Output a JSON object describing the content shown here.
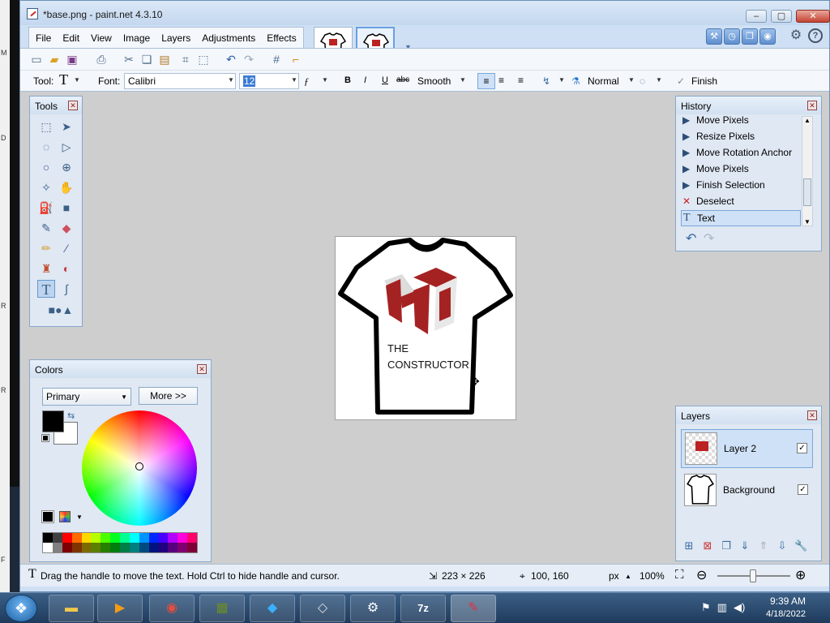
{
  "window": {
    "title": "*base.png - paint.net 4.3.10"
  },
  "menus": [
    "File",
    "Edit",
    "View",
    "Image",
    "Layers",
    "Adjustments",
    "Effects"
  ],
  "toolbar": {
    "tool_label": "Tool:",
    "font_label": "Font:",
    "font_value": "Calibri",
    "size_value": "12",
    "antialias_value": "Smooth",
    "blend_value": "Normal",
    "finish_label": "Finish",
    "bold": "B",
    "italic": "I",
    "underline": "U",
    "strike": "abc"
  },
  "tools_panel": {
    "title": "Tools"
  },
  "colors_panel": {
    "title": "Colors",
    "mode": "Primary",
    "more_label": "More >>",
    "primary_color": "#000000",
    "secondary_color": "#ffffff"
  },
  "history_panel": {
    "title": "History",
    "items": [
      "Move Pixels",
      "Resize Pixels",
      "Move Rotation Anchor",
      "Move Pixels",
      "Finish Selection",
      "Deselect",
      "Text"
    ],
    "selected_index": 6
  },
  "layers_panel": {
    "title": "Layers",
    "layers": [
      {
        "name": "Layer 2",
        "visible": true,
        "selected": true
      },
      {
        "name": "Background",
        "visible": true,
        "selected": false
      }
    ]
  },
  "canvas": {
    "text_line1": "THE",
    "text_line2": "CONSTRUCTOR",
    "logo_text": "HI"
  },
  "status": {
    "hint": "Drag the handle to move the text. Hold Ctrl to hide handle and cursor.",
    "image_size": "223 × 226",
    "cursor_pos": "100, 160",
    "units": "px",
    "zoom": "100%"
  },
  "desktop_labels": [
    "M",
    "D",
    "R",
    "R",
    "F"
  ],
  "taskbar": {
    "clock_time": "9:39 AM",
    "clock_date": "4/18/2022"
  },
  "palette": [
    "#000000",
    "#404040",
    "#ff0000",
    "#ff6a00",
    "#ffd800",
    "#b6ff00",
    "#4cff00",
    "#00ff21",
    "#00ff90",
    "#00ffff",
    "#0094ff",
    "#0026ff",
    "#4800ff",
    "#b200ff",
    "#ff00dc",
    "#ff006e",
    "#ffffff",
    "#808080",
    "#7f0000",
    "#7f3300",
    "#7f6a00",
    "#5b7f00",
    "#267f00",
    "#007f0e",
    "#007f46",
    "#007f7f",
    "#004a7f",
    "#00137f",
    "#21007f",
    "#57007f",
    "#7f006e",
    "#7f0037"
  ]
}
